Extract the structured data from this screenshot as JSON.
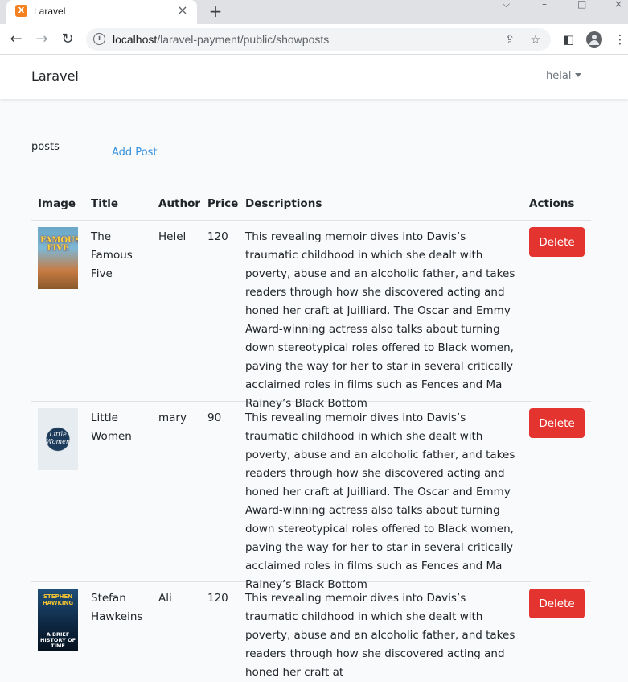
{
  "browser": {
    "tab_title": "Laravel",
    "tab_favicon_letter": "X",
    "url_host": "localhost",
    "url_path": "/laravel-payment/public/showposts"
  },
  "navbar": {
    "brand": "Laravel",
    "user": "helal"
  },
  "page": {
    "posts_label": "posts",
    "add_post": "Add Post"
  },
  "table": {
    "headers": {
      "image": "Image",
      "title": "Title",
      "author": "Author",
      "price": "Price",
      "descriptions": "Descriptions",
      "actions": "Actions"
    },
    "rows": [
      {
        "cover_text": "FAMOUS FIVE",
        "title": "The Famous Five",
        "author": "Helel",
        "price": "120",
        "description": "This revealing memoir dives into Davis’s traumatic childhood in which she dealt with poverty, abuse and an alcoholic father, and takes readers through how she discovered acting and honed her craft at Juilliard. The Oscar and Emmy Award-winning actress also talks about turning down stereotypical roles offered to Black women, paving the way for her to star in several critically acclaimed roles in films such as Fences and Ma Rainey’s Black Bottom",
        "action": "Delete"
      },
      {
        "cover_text": "Little Women",
        "title": "Little Women",
        "author": "mary",
        "price": "90",
        "description": "This revealing memoir dives into Davis’s traumatic childhood in which she dealt with poverty, abuse and an alcoholic father, and takes readers through how she discovered acting and honed her craft at Juilliard. The Oscar and Emmy Award-winning actress also talks about turning down stereotypical roles offered to Black women, paving the way for her to star in several critically acclaimed roles in films such as Fences and Ma Rainey’s Black Bottom",
        "action": "Delete"
      },
      {
        "cover_text_top": "STEPHEN HAWKING",
        "cover_text_bottom": "A BRIEF HISTORY OF TIME",
        "title": "Stefan Hawkeins",
        "author": "Ali",
        "price": "120",
        "description": "This revealing memoir dives into Davis’s traumatic childhood in which she dealt with poverty, abuse and an alcoholic father, and takes readers through how she discovered acting and honed her craft at",
        "action": "Delete"
      }
    ]
  }
}
